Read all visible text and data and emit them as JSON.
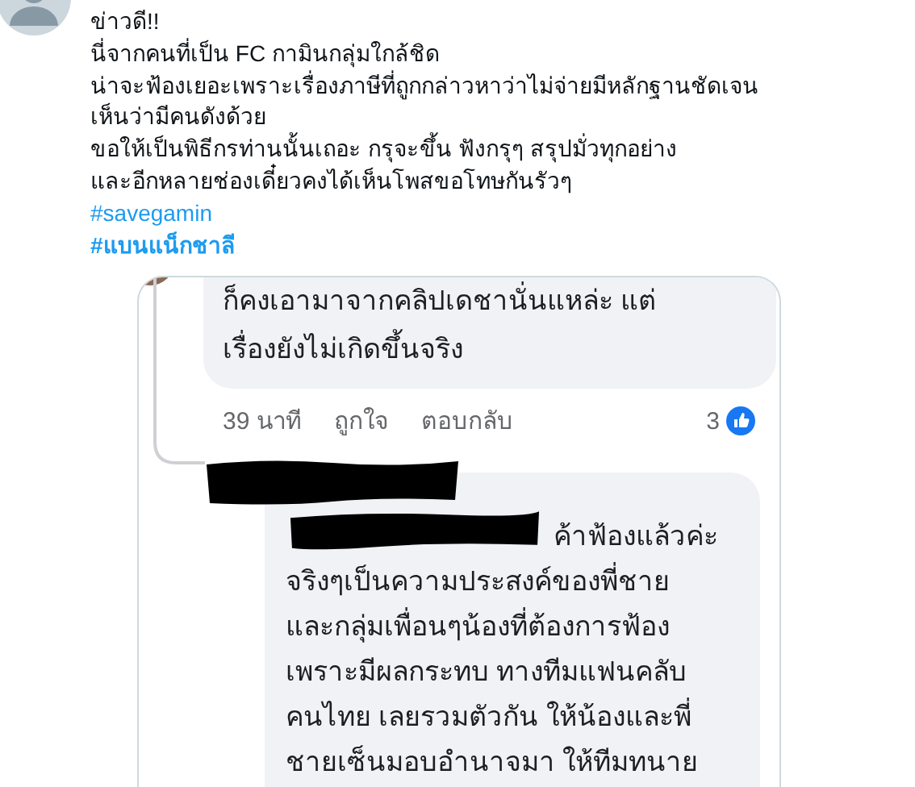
{
  "post": {
    "lines": [
      "ข่าวดี!!",
      "นี่จากคนที่เป็น FC กามินกลุ่มใกล้ชิด",
      "น่าจะฟ้องเยอะเพราะเรื่องภาษีที่ถูกกล่าวหาว่าไม่จ่ายมีหลักฐานชัดเจน",
      "เห็นว่ามีคนดังด้วย",
      "ขอให้เป็นพิธีกรท่านนั้นเถอะ กรุจะขึ้น ฟังกรุๆ สรุปมั่วทุกอย่าง",
      "และอีกหลายช่องเดี๋ยวคงได้เห็นโพสขอโทษกันรัวๆ"
    ],
    "hashtags": [
      {
        "text": "#savegamin",
        "bold": false
      },
      {
        "text": "#แบนแน็กชาลี",
        "bold": true
      }
    ]
  },
  "embedded_screenshot": {
    "comment": {
      "lines": [
        "ก็คงเอามาจากคลิปเดชานั่นแหล่ะ แต่",
        "เรื่องยังไม่เกิดขึ้นจริง"
      ],
      "time": "39 นาที",
      "actions": [
        "ถูกใจ",
        "ตอบกลับ"
      ],
      "reaction_count": "3"
    },
    "reply": {
      "lines": [
        "ค้าฟ้องแล้วค่ะ",
        "จริงๆเป็นความประสงค์ของพี่ชาย",
        "และกลุ่มเพื่อนๆน้องที่ต้องการฟ้อง",
        "เพราะมีผลกระทบ ทางทีมแฟนคลับ",
        "คนไทย เลยรวมตัวกัน ให้น้องและพี่",
        "ชายเซ็นมอบอำนาจมา ให้ทีมทนาย"
      ]
    }
  }
}
